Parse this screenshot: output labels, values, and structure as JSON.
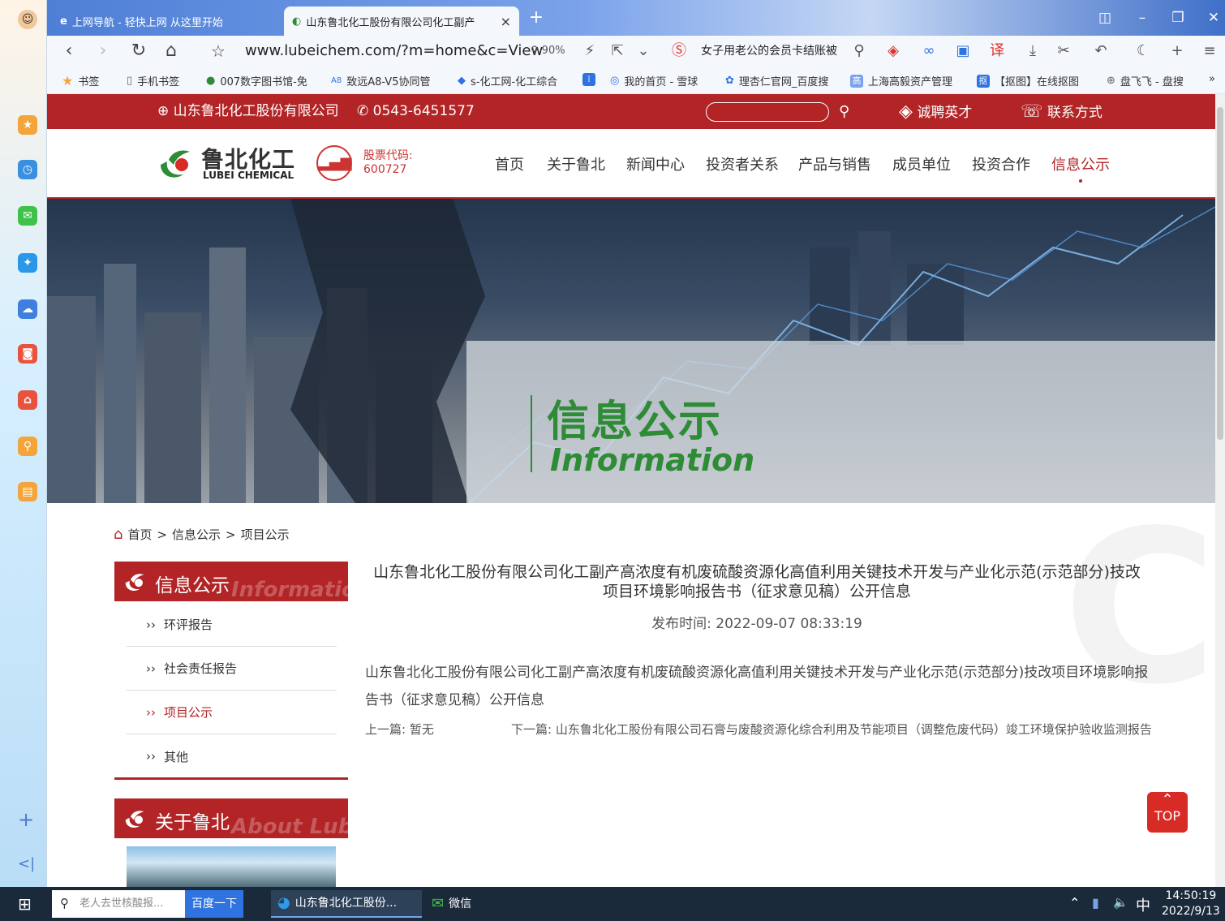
{
  "browser": {
    "tabs": [
      {
        "label": "上网导航 - 轻快上网 从这里开始"
      },
      {
        "label": "山东鲁北化工股份有限公司化工副产",
        "close": "×"
      }
    ],
    "new_tab": "+",
    "url": "www.lubeichem.com/?m=home&c=View",
    "zoom": "90%",
    "search_text": "女子用老公的会员卡结账被",
    "bookmarks": [
      {
        "label": "书签"
      },
      {
        "label": "手机书签"
      },
      {
        "label": "007数字图书馆-免"
      },
      {
        "label": "致远A8-V5协同管"
      },
      {
        "label": "s-化工网-化工综合"
      },
      {
        "label": "我的首页 - 雪球"
      },
      {
        "label": "理杏仁官网_百度搜"
      },
      {
        "label": "上海高毅资产管理"
      },
      {
        "label": "【抠图】在线抠图"
      },
      {
        "label": "盘飞飞 - 盘搜"
      }
    ],
    "bookmarks_more": "»"
  },
  "site": {
    "company": "山东鲁北化工股份有限公司",
    "phone": "0543-6451577",
    "jobs": "诚聘英才",
    "contact": "联系方式",
    "logo_cn": "鲁北化工",
    "logo_en": "LUBEI CHEMICAL",
    "stock_label": "股票代码:",
    "stock_code": "600727",
    "nav": [
      "首页",
      "关于鲁北",
      "新闻中心",
      "投资者关系",
      "产品与销售",
      "成员单位",
      "投资合作",
      "信息公示"
    ],
    "banner_cn": "信息公示",
    "banner_en": "Information"
  },
  "breadcrumb": {
    "home": "首页",
    "sep1": ">",
    "level1": "信息公示",
    "sep2": ">",
    "level2": "项目公示"
  },
  "sidebar": {
    "title_cn": "信息公示",
    "title_en": "Information",
    "items": [
      {
        "label": "环评报告"
      },
      {
        "label": "社会责任报告"
      },
      {
        "label": "项目公示"
      },
      {
        "label": "其他"
      }
    ],
    "bullet": "››",
    "about_cn": "关于鲁北",
    "about_en": "About Lubei"
  },
  "article": {
    "title_line1": "山东鲁北化工股份有限公司化工副产高浓度有机废硫酸资源化高值利用关键技术开发与产业化示范(示范部分)技改",
    "title_line2": "项目环境影响报告书（征求意见稿）公开信息",
    "time_label": "发布时间:",
    "time": "2022-09-07 08:33:19",
    "body": "山东鲁北化工股份有限公司化工副产高浓度有机废硫酸资源化高值利用关键技术开发与产业化示范(示范部分)技改项目环境影响报告书（征求意见稿）公开信息",
    "prev_label": "上一篇:",
    "prev": "暂无",
    "next_label": "下一篇:",
    "next": "山东鲁北化工股份有限公司石膏与废酸资源化综合利用及节能项目（调整危废代码）竣工环境保护验收监测报告"
  },
  "watermark": "CHE",
  "top_button": "TOP",
  "taskbar": {
    "search_placeholder": "老人去世核酸报...",
    "search_button": "百度一下",
    "apps": [
      {
        "label": "山东鲁北化工股份..."
      },
      {
        "label": "微信"
      }
    ],
    "ime": "中",
    "time": "14:50:19",
    "date": "2022/9/13"
  },
  "colors": {
    "brand_red": "#b22426",
    "brand_green": "#2e8b36"
  }
}
